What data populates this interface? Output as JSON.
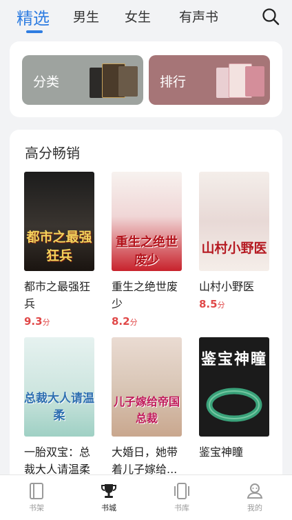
{
  "header": {
    "tabs": [
      {
        "label": "精选"
      },
      {
        "label": "男生"
      },
      {
        "label": "女生"
      },
      {
        "label": "有声书"
      }
    ],
    "search_icon": "search-icon"
  },
  "shortcuts": [
    {
      "label": "分类",
      "bg": "#9ea39f"
    },
    {
      "label": "排行",
      "bg": "#a67577"
    }
  ],
  "section": {
    "title": "高分畅销",
    "books": [
      {
        "title": "都市之最强狂兵",
        "score": "9.3",
        "unit": "分",
        "cover_text": "都市之最强狂兵"
      },
      {
        "title": "重生之绝世废少",
        "score": "8.2",
        "unit": "分",
        "cover_text": "重生之绝世废少"
      },
      {
        "title": "山村小野医",
        "score": "8.5",
        "unit": "分",
        "cover_text": "山村小野医"
      },
      {
        "title": "一胎双宝：总裁大人请温柔",
        "score": "",
        "unit": "",
        "cover_text": "总裁大人请温柔"
      },
      {
        "title": "大婚日，她带着儿子嫁给...",
        "score": "",
        "unit": "",
        "cover_text": "儿子嫁给帝国总裁"
      },
      {
        "title": "鉴宝神瞳",
        "score": "",
        "unit": "",
        "cover_text": "鉴宝神瞳"
      }
    ]
  },
  "bottom_nav": [
    {
      "label": "书架",
      "icon": "bookshelf-icon"
    },
    {
      "label": "书城",
      "icon": "trophy-icon"
    },
    {
      "label": "书库",
      "icon": "library-icon"
    },
    {
      "label": "我的",
      "icon": "profile-icon"
    }
  ],
  "colors": {
    "accent": "#2f7de1",
    "score": "#e04848"
  }
}
